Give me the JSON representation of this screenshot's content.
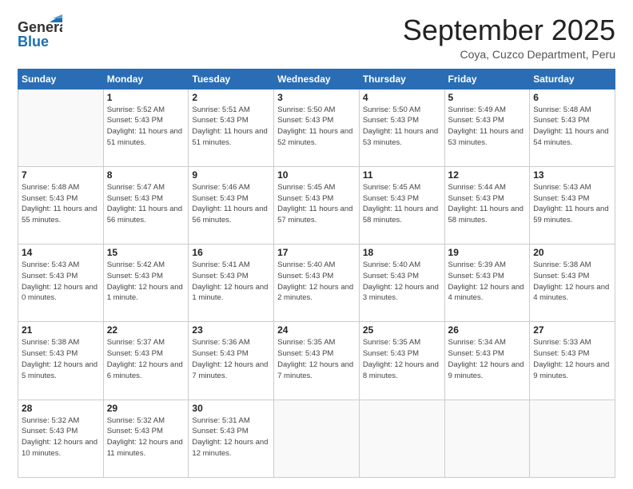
{
  "header": {
    "logo_line1": "General",
    "logo_line2": "Blue",
    "month_title": "September 2025",
    "location": "Coya, Cuzco Department, Peru"
  },
  "days_of_week": [
    "Sunday",
    "Monday",
    "Tuesday",
    "Wednesday",
    "Thursday",
    "Friday",
    "Saturday"
  ],
  "weeks": [
    [
      {
        "day": "",
        "sunrise": "",
        "sunset": "",
        "daylight": ""
      },
      {
        "day": "1",
        "sunrise": "Sunrise: 5:52 AM",
        "sunset": "Sunset: 5:43 PM",
        "daylight": "Daylight: 11 hours and 51 minutes."
      },
      {
        "day": "2",
        "sunrise": "Sunrise: 5:51 AM",
        "sunset": "Sunset: 5:43 PM",
        "daylight": "Daylight: 11 hours and 51 minutes."
      },
      {
        "day": "3",
        "sunrise": "Sunrise: 5:50 AM",
        "sunset": "Sunset: 5:43 PM",
        "daylight": "Daylight: 11 hours and 52 minutes."
      },
      {
        "day": "4",
        "sunrise": "Sunrise: 5:50 AM",
        "sunset": "Sunset: 5:43 PM",
        "daylight": "Daylight: 11 hours and 53 minutes."
      },
      {
        "day": "5",
        "sunrise": "Sunrise: 5:49 AM",
        "sunset": "Sunset: 5:43 PM",
        "daylight": "Daylight: 11 hours and 53 minutes."
      },
      {
        "day": "6",
        "sunrise": "Sunrise: 5:48 AM",
        "sunset": "Sunset: 5:43 PM",
        "daylight": "Daylight: 11 hours and 54 minutes."
      }
    ],
    [
      {
        "day": "7",
        "sunrise": "Sunrise: 5:48 AM",
        "sunset": "Sunset: 5:43 PM",
        "daylight": "Daylight: 11 hours and 55 minutes."
      },
      {
        "day": "8",
        "sunrise": "Sunrise: 5:47 AM",
        "sunset": "Sunset: 5:43 PM",
        "daylight": "Daylight: 11 hours and 56 minutes."
      },
      {
        "day": "9",
        "sunrise": "Sunrise: 5:46 AM",
        "sunset": "Sunset: 5:43 PM",
        "daylight": "Daylight: 11 hours and 56 minutes."
      },
      {
        "day": "10",
        "sunrise": "Sunrise: 5:45 AM",
        "sunset": "Sunset: 5:43 PM",
        "daylight": "Daylight: 11 hours and 57 minutes."
      },
      {
        "day": "11",
        "sunrise": "Sunrise: 5:45 AM",
        "sunset": "Sunset: 5:43 PM",
        "daylight": "Daylight: 11 hours and 58 minutes."
      },
      {
        "day": "12",
        "sunrise": "Sunrise: 5:44 AM",
        "sunset": "Sunset: 5:43 PM",
        "daylight": "Daylight: 11 hours and 58 minutes."
      },
      {
        "day": "13",
        "sunrise": "Sunrise: 5:43 AM",
        "sunset": "Sunset: 5:43 PM",
        "daylight": "Daylight: 11 hours and 59 minutes."
      }
    ],
    [
      {
        "day": "14",
        "sunrise": "Sunrise: 5:43 AM",
        "sunset": "Sunset: 5:43 PM",
        "daylight": "Daylight: 12 hours and 0 minutes."
      },
      {
        "day": "15",
        "sunrise": "Sunrise: 5:42 AM",
        "sunset": "Sunset: 5:43 PM",
        "daylight": "Daylight: 12 hours and 1 minute."
      },
      {
        "day": "16",
        "sunrise": "Sunrise: 5:41 AM",
        "sunset": "Sunset: 5:43 PM",
        "daylight": "Daylight: 12 hours and 1 minute."
      },
      {
        "day": "17",
        "sunrise": "Sunrise: 5:40 AM",
        "sunset": "Sunset: 5:43 PM",
        "daylight": "Daylight: 12 hours and 2 minutes."
      },
      {
        "day": "18",
        "sunrise": "Sunrise: 5:40 AM",
        "sunset": "Sunset: 5:43 PM",
        "daylight": "Daylight: 12 hours and 3 minutes."
      },
      {
        "day": "19",
        "sunrise": "Sunrise: 5:39 AM",
        "sunset": "Sunset: 5:43 PM",
        "daylight": "Daylight: 12 hours and 4 minutes."
      },
      {
        "day": "20",
        "sunrise": "Sunrise: 5:38 AM",
        "sunset": "Sunset: 5:43 PM",
        "daylight": "Daylight: 12 hours and 4 minutes."
      }
    ],
    [
      {
        "day": "21",
        "sunrise": "Sunrise: 5:38 AM",
        "sunset": "Sunset: 5:43 PM",
        "daylight": "Daylight: 12 hours and 5 minutes."
      },
      {
        "day": "22",
        "sunrise": "Sunrise: 5:37 AM",
        "sunset": "Sunset: 5:43 PM",
        "daylight": "Daylight: 12 hours and 6 minutes."
      },
      {
        "day": "23",
        "sunrise": "Sunrise: 5:36 AM",
        "sunset": "Sunset: 5:43 PM",
        "daylight": "Daylight: 12 hours and 7 minutes."
      },
      {
        "day": "24",
        "sunrise": "Sunrise: 5:35 AM",
        "sunset": "Sunset: 5:43 PM",
        "daylight": "Daylight: 12 hours and 7 minutes."
      },
      {
        "day": "25",
        "sunrise": "Sunrise: 5:35 AM",
        "sunset": "Sunset: 5:43 PM",
        "daylight": "Daylight: 12 hours and 8 minutes."
      },
      {
        "day": "26",
        "sunrise": "Sunrise: 5:34 AM",
        "sunset": "Sunset: 5:43 PM",
        "daylight": "Daylight: 12 hours and 9 minutes."
      },
      {
        "day": "27",
        "sunrise": "Sunrise: 5:33 AM",
        "sunset": "Sunset: 5:43 PM",
        "daylight": "Daylight: 12 hours and 9 minutes."
      }
    ],
    [
      {
        "day": "28",
        "sunrise": "Sunrise: 5:32 AM",
        "sunset": "Sunset: 5:43 PM",
        "daylight": "Daylight: 12 hours and 10 minutes."
      },
      {
        "day": "29",
        "sunrise": "Sunrise: 5:32 AM",
        "sunset": "Sunset: 5:43 PM",
        "daylight": "Daylight: 12 hours and 11 minutes."
      },
      {
        "day": "30",
        "sunrise": "Sunrise: 5:31 AM",
        "sunset": "Sunset: 5:43 PM",
        "daylight": "Daylight: 12 hours and 12 minutes."
      },
      {
        "day": "",
        "sunrise": "",
        "sunset": "",
        "daylight": ""
      },
      {
        "day": "",
        "sunrise": "",
        "sunset": "",
        "daylight": ""
      },
      {
        "day": "",
        "sunrise": "",
        "sunset": "",
        "daylight": ""
      },
      {
        "day": "",
        "sunrise": "",
        "sunset": "",
        "daylight": ""
      }
    ]
  ]
}
